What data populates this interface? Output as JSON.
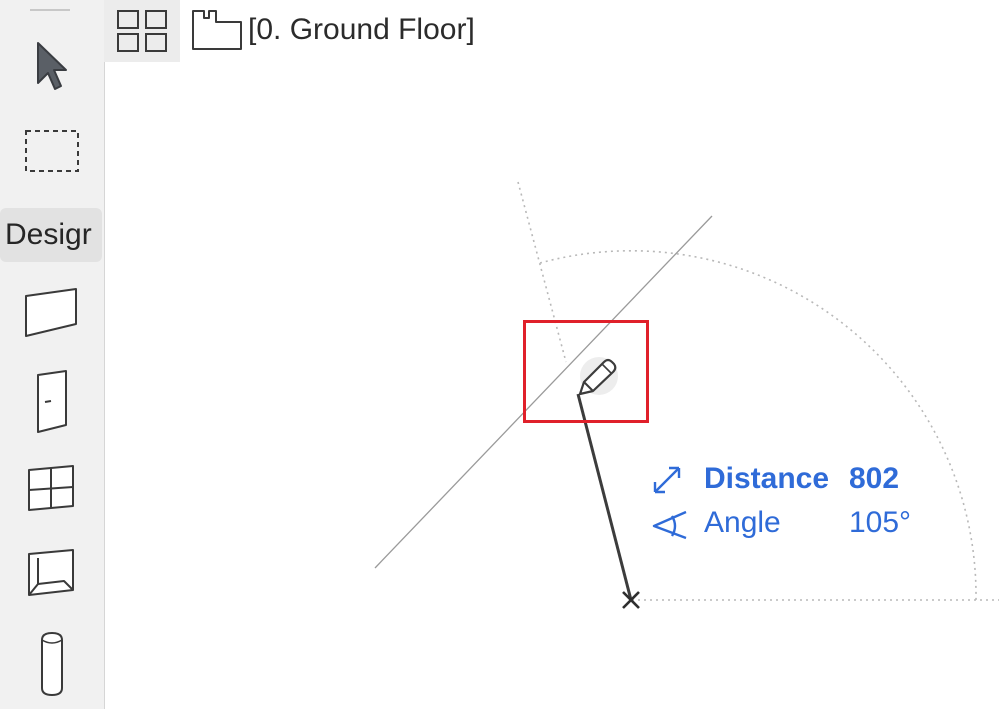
{
  "toolbox": {
    "section_label": "Desigr",
    "tools": [
      "arrow-tool",
      "marquee-tool",
      "wall-tool",
      "door-tool",
      "window-tool",
      "skylight-tool",
      "column-tool"
    ]
  },
  "viewbar": {
    "story_name": "[0. Ground Floor]"
  },
  "tracker": {
    "distance_label": "Distance",
    "distance_value": "802",
    "angle_label": "Angle",
    "angle_value": "105°",
    "color": "#2f6bd8"
  },
  "highlight": {
    "color": "#e0202a"
  }
}
